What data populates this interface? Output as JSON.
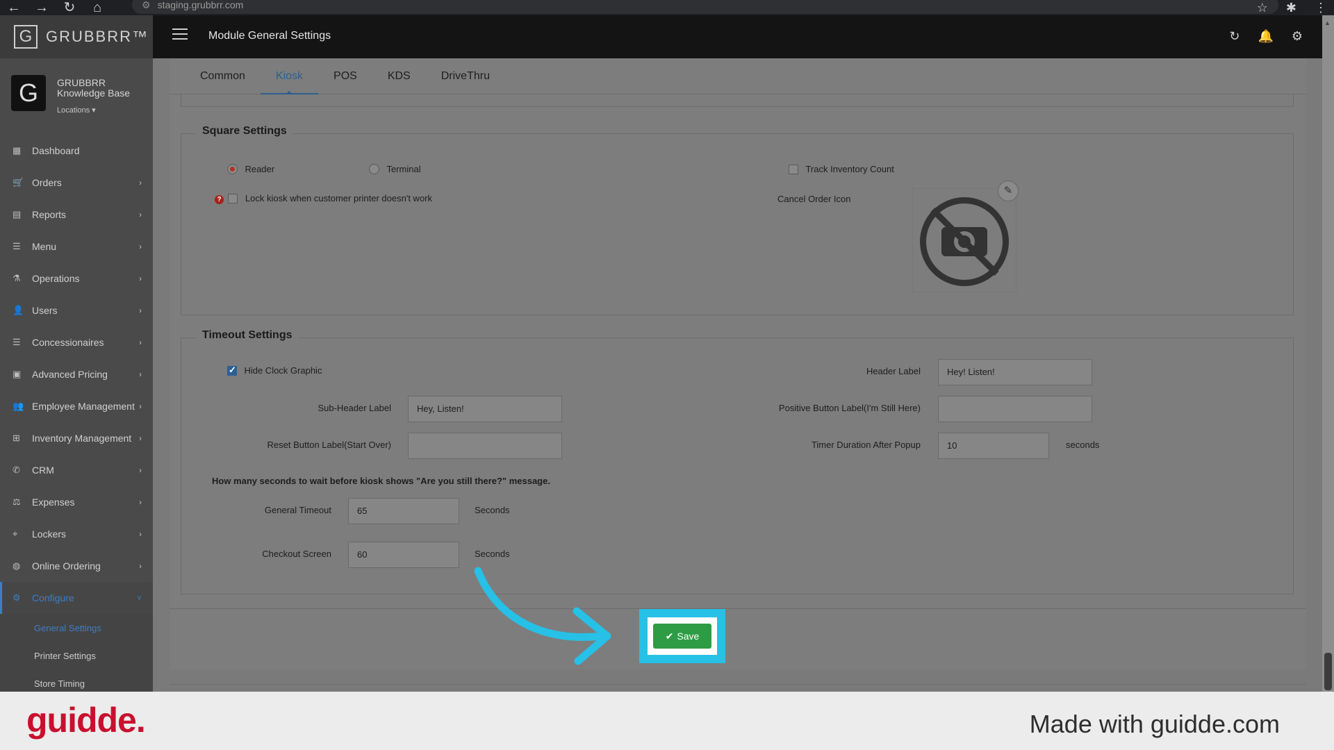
{
  "browser": {
    "url": "staging.grubbrr.com",
    "back_icon": "arrow-left-icon",
    "forward_icon": "arrow-right-icon",
    "reload_icon": "reload-icon",
    "home_icon": "home-icon"
  },
  "app": {
    "logo_text": "GRUBBRR™",
    "logo_letter": "G",
    "page_title": "Module General Settings"
  },
  "profile": {
    "avatar_letter": "G",
    "name": "GRUBBRR Knowledge Base",
    "locations_label": "Locations ▾"
  },
  "sidebar": {
    "items": [
      {
        "label": "Dashboard",
        "icon": "▦",
        "chevron": ""
      },
      {
        "label": "Orders",
        "icon": "🛒",
        "chevron": "›"
      },
      {
        "label": "Reports",
        "icon": "▤",
        "chevron": "›"
      },
      {
        "label": "Menu",
        "icon": "☰",
        "chevron": "›"
      },
      {
        "label": "Operations",
        "icon": "⚗",
        "chevron": "›"
      },
      {
        "label": "Users",
        "icon": "👤",
        "chevron": "›"
      },
      {
        "label": "Concessionaires",
        "icon": "☰",
        "chevron": "›"
      },
      {
        "label": "Advanced Pricing",
        "icon": "▣",
        "chevron": "›"
      },
      {
        "label": "Employee Management",
        "icon": "👥",
        "chevron": "›"
      },
      {
        "label": "Inventory Management",
        "icon": "⊞",
        "chevron": "›"
      },
      {
        "label": "CRM",
        "icon": "✆",
        "chevron": "›"
      },
      {
        "label": "Expenses",
        "icon": "⚖",
        "chevron": "›"
      },
      {
        "label": "Lockers",
        "icon": "⌖",
        "chevron": "›"
      },
      {
        "label": "Online Ordering",
        "icon": "◍",
        "chevron": "›"
      },
      {
        "label": "Configure",
        "icon": "⚙",
        "chevron": "˅"
      }
    ],
    "sub_items": [
      {
        "label": "General Settings"
      },
      {
        "label": "Printer Settings"
      },
      {
        "label": "Store Timing"
      }
    ]
  },
  "tabs": [
    {
      "label": "Common"
    },
    {
      "label": "Kiosk"
    },
    {
      "label": "POS"
    },
    {
      "label": "KDS"
    },
    {
      "label": "DriveThru"
    }
  ],
  "square_settings": {
    "title": "Square Settings",
    "reader_label": "Reader",
    "terminal_label": "Terminal",
    "selected": "Reader",
    "track_inventory_label": "Track Inventory Count",
    "track_inventory_checked": false,
    "lock_kiosk_label": "Lock kiosk when customer printer doesn't work",
    "lock_kiosk_checked": false,
    "help_mark": "?",
    "cancel_order_icon_label": "Cancel Order Icon"
  },
  "timeout_settings": {
    "title": "Timeout Settings",
    "hide_clock_label": "Hide Clock Graphic",
    "hide_clock_checked": true,
    "header_label": "Header Label",
    "header_value": "Hey! Listen!",
    "sub_header_label": "Sub-Header Label",
    "sub_header_value": "Hey, Listen!",
    "positive_button_label": "Positive Button Label(I'm Still Here)",
    "positive_button_value": "",
    "reset_button_label": "Reset Button Label(Start Over)",
    "reset_button_value": "",
    "timer_duration_label": "Timer Duration After Popup",
    "timer_duration_value": "10",
    "timer_duration_unit": "seconds",
    "note": "How many seconds to wait before kiosk shows \"Are you still there?\" message.",
    "general_timeout_label": "General Timeout",
    "general_timeout_value": "65",
    "general_timeout_unit": "Seconds",
    "checkout_screen_label": "Checkout Screen",
    "checkout_screen_value": "60",
    "checkout_screen_unit": "Seconds"
  },
  "save_button": {
    "label": "Save",
    "icon": "✔"
  },
  "footer": {
    "brand": "guidde.",
    "tagline": "Made with guidde.com"
  },
  "colors": {
    "highlight": "#27c0e6",
    "save": "#2e9c45",
    "brand_red": "#c8102e",
    "active_blue": "#3d7ec7"
  }
}
